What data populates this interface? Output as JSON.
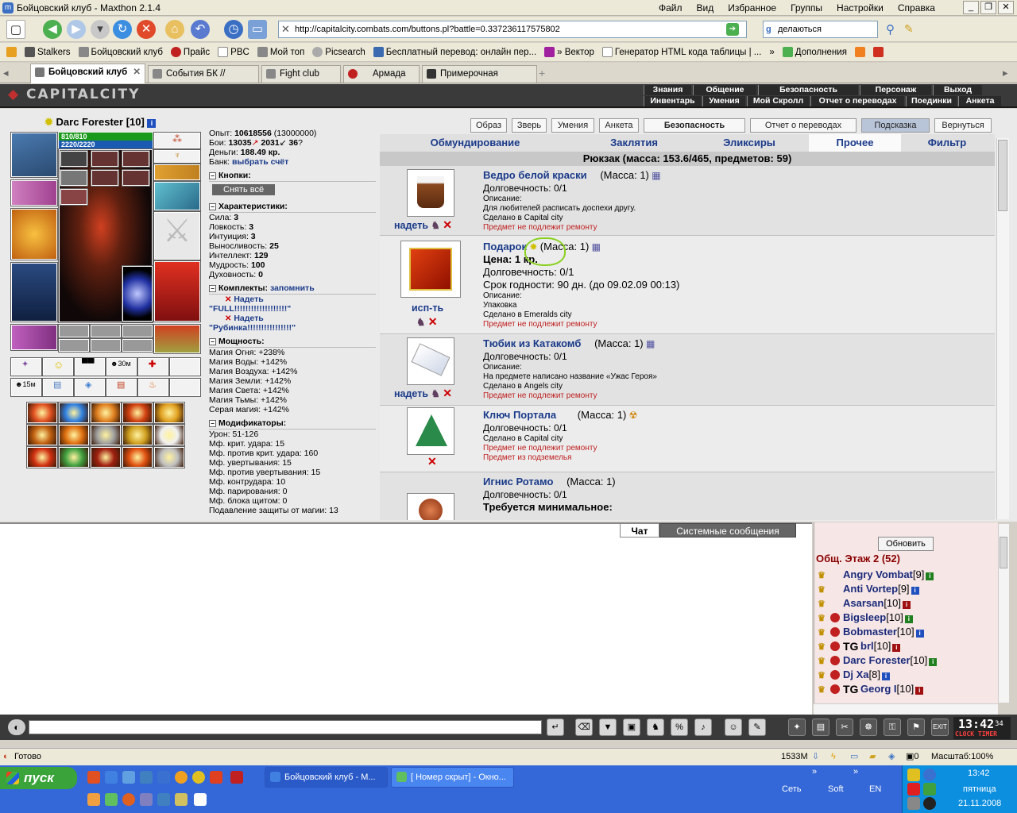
{
  "window": {
    "title": "Бойцовский клуб - Maxthon 2.1.4",
    "menu": [
      "Файл",
      "Вид",
      "Избранное",
      "Группы",
      "Настройки",
      "Справка"
    ]
  },
  "toolbar": {
    "address": "http://capitalcity.combats.com/buttons.pl?battle=0.337236117575802",
    "search_text": "делаються"
  },
  "bookmarks": [
    "Stalkers",
    "Бойцовский клуб",
    "Прайс",
    "PBC",
    "Мой топ",
    "Picsearch",
    "Бесплатный перевод: онлайн пер...",
    "» Вектор",
    "Генератор HTML кода таблицы | ...",
    "»",
    "Дополнения"
  ],
  "tabs": [
    "Бойцовский клуб",
    "События БК // Stalkers",
    "Fight club",
    "Армада",
    "Примерочная DarkClan"
  ],
  "game": {
    "logo": "CAPITALCITY",
    "nav_top": [
      "Знания",
      "Общение",
      "Безопасность",
      "Персонаж",
      "Выход"
    ],
    "nav_bottom": [
      "Инвентарь",
      "Умения",
      "Мой Скролл",
      "Отчет о переводах",
      "Поединки",
      "Анкета"
    ]
  },
  "character": {
    "name": "Darc Forester",
    "level": "[10]",
    "hp": "810/810",
    "mana": "2220/2220",
    "hp_fill": 1.0,
    "mana_fill": 1.0
  },
  "stats": {
    "exp_label": "Опыт:",
    "exp_value": "10618556",
    "exp_next": "(13000000)",
    "fights_label": "Бои:",
    "fights_win": "13035",
    "fights_loss": "2031",
    "fights_draw": "36",
    "money_label": "Деньги:",
    "money_value": "188.49 кр.",
    "bank_label": "Банк:",
    "bank_link": "выбрать счёт",
    "buttons_title": "Кнопки:",
    "remove_all": "Снять всё",
    "chars_title": "Характеристики:",
    "chars": [
      [
        "Сила:",
        "3"
      ],
      [
        "Ловкость:",
        "3"
      ],
      [
        "Интуиция:",
        "3"
      ],
      [
        "Выносливость:",
        "25"
      ],
      [
        "Интеллект:",
        "129"
      ],
      [
        "Мудрость:",
        "100"
      ],
      [
        "Духовность:",
        "0"
      ]
    ],
    "sets_title": "Комплекты:",
    "sets_remember": "запомнить",
    "sets": [
      {
        "action": "Надеть",
        "name": "\"FULL!!!!!!!!!!!!!!!!!!!\""
      },
      {
        "action": "Надеть",
        "name": "\"Рубинка!!!!!!!!!!!!!!!!\""
      }
    ],
    "power_title": "Мощность:",
    "power": [
      "Магия Огня: +238%",
      "Магия Воды: +142%",
      "Магия Воздуха: +142%",
      "Магия Земли: +142%",
      "Магия Света: +142%",
      "Магия Тьмы: +142%",
      "Серая магия: +142%"
    ],
    "mods_title": "Модификаторы:",
    "mods": [
      "Урон: 51-126",
      "Мф. крит. удара: 15",
      "Мф. против крит. удара: 160",
      "Мф. увертывания: 15",
      "Мф. против увертывания: 15",
      "Мф. контрудара: 10",
      "Мф. парирования: 0",
      "Мф. блока щитом: 0",
      "Подавление защиты от магии: 13"
    ]
  },
  "top_buttons": [
    "Образ",
    "Зверь",
    "Умения",
    "Анкета",
    "Безопасность",
    "Отчет о переводах",
    "Подсказка",
    "Вернуться"
  ],
  "category_tabs": [
    "Обмундирование",
    "Заклятия",
    "Эликсиры",
    "Прочее",
    "Фильтр"
  ],
  "backpack_title": "Рюкзак (масса: 153.6/465, предметов: 59)",
  "items": [
    {
      "name": "Ведро белой краски",
      "mass": "(Масса: 1)",
      "action": "надеть",
      "lines": [
        "Долговечность: 0/1"
      ],
      "desc_label": "Описание:",
      "small": [
        "Для любителей расписать доспехи другу.",
        "Сделано в Capital city"
      ],
      "red": [
        "Предмет не подлежит ремонту"
      ]
    },
    {
      "name": "Подарок",
      "mass": "(Масса: 1)",
      "action": "исп-ть",
      "price": "Цена: 1 кр.",
      "lines": [
        "Долговечность: 0/1",
        "Срок годности: 90 дн. (до 09.02.09 00:13)"
      ],
      "desc_label": "Описание:",
      "small": [
        "Упаковка",
        "Сделано в Emeralds city"
      ],
      "red": [
        "Предмет не подлежит ремонту"
      ]
    },
    {
      "name": "Тюбик из Катакомб",
      "mass": "(Масса: 1)",
      "action": "надеть",
      "lines": [
        "Долговечность: 0/1"
      ],
      "desc_label": "Описание:",
      "small": [
        "На предмете написано название «Ужас Героя»",
        "Сделано в Angels city"
      ],
      "red": [
        "Предмет не подлежит ремонту"
      ]
    },
    {
      "name": "Ключ Портала",
      "mass": "(Масса: 1)",
      "lines": [
        "Долговечность: 0/1"
      ],
      "small": [
        "Сделано в Capital city"
      ],
      "red": [
        "Предмет не подлежит ремонту",
        "Предмет из подземелья"
      ]
    },
    {
      "name": "Игнис Ротамо",
      "mass": "(Масса: 1)",
      "lines": [
        "Долговечность: 0/1"
      ],
      "req": "Требуется минимальное:"
    }
  ],
  "chat": {
    "tab_chat": "Чат",
    "tab_system": "Системные сообщения"
  },
  "online": {
    "refresh": "Обновить",
    "room": "Общ. Этаж 2 (52)",
    "users": [
      {
        "name": "Angry Vombat",
        "level": "[9]"
      },
      {
        "name": "Anti Vortep",
        "level": "[9]"
      },
      {
        "name": "Asarsan",
        "level": "[10]"
      },
      {
        "name": "Bigsleep",
        "level": "[10]"
      },
      {
        "name": "Bobmaster",
        "level": "[10]"
      },
      {
        "name": "brl",
        "level": "[10]",
        "clan": "TG"
      },
      {
        "name": "Darc Forester",
        "level": "[10]"
      },
      {
        "name": "Dj Xa",
        "level": "[8]"
      },
      {
        "name": "Georg I",
        "level": "[10]",
        "clan": "TG"
      }
    ]
  },
  "clock": {
    "time": "13:42",
    "sec": "34",
    "label": "CLOCK TIMER"
  },
  "statusbar": {
    "text": "Готово",
    "mem": "1533M",
    "zoom": "Масштаб:100%"
  },
  "taskbar": {
    "start": "пуск",
    "tasks": [
      "Бойцовский клуб - М...",
      "[ Номер скрыт] - Окно..."
    ],
    "lang": [
      "Сеть",
      "Soft",
      "EN"
    ],
    "time": "13:42",
    "day": "пятница",
    "date": "21.11.2008"
  }
}
